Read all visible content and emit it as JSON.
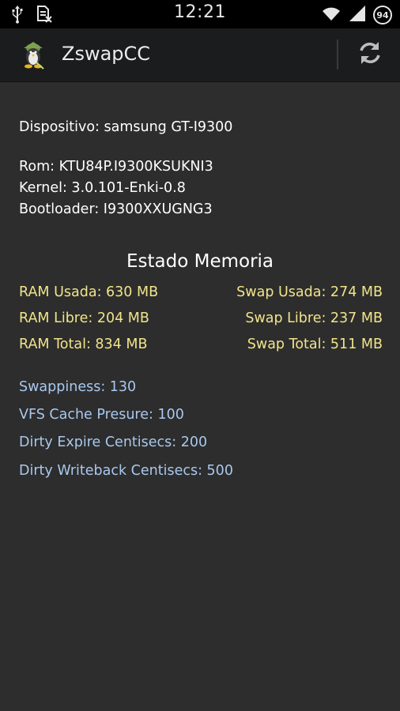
{
  "status_bar": {
    "time": "12:21",
    "battery": "94",
    "icons": [
      "usb-icon",
      "sd-card-icon",
      "wifi-icon",
      "signal-icon"
    ]
  },
  "app_bar": {
    "title": "ZswapCC",
    "icon": "penguin-app-icon",
    "refresh_icon": "refresh-icon"
  },
  "device": {
    "dispositivo": "Dispositivo: samsung GT-I9300",
    "rom": "Rom: KTU84P.I9300KSUKNI3",
    "kernel": "Kernel: 3.0.101-Enki-0.8",
    "bootloader": "Bootloader: I9300XXUGNG3"
  },
  "memory": {
    "title": "Estado Memoria",
    "ram_usada": "RAM Usada: 630 MB",
    "ram_libre": "RAM Libre: 204 MB",
    "ram_total": "RAM Total: 834 MB",
    "swap_usada": "Swap Usada: 274 MB",
    "swap_libre": "Swap Libre: 237 MB",
    "swap_total": "Swap Total: 511 MB"
  },
  "params": {
    "swappiness": "Swappiness: 130",
    "vfs_cache": "VFS Cache Presure: 100",
    "dirty_expire": "Dirty Expire Centisecs: 200",
    "dirty_writeback": "Dirty Writeback Centisecs: 500"
  },
  "colors": {
    "background": "#2d2d2d",
    "memory_text": "#f1e48a",
    "param_text": "#a9c8ee"
  }
}
